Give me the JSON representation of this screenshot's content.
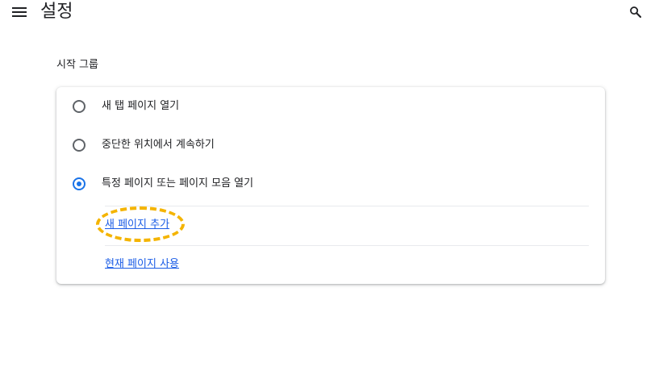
{
  "header": {
    "title": "설정",
    "menu_icon": "hamburger-menu-icon",
    "search_icon": "search-icon"
  },
  "section": {
    "title": "시작 그룹"
  },
  "startup_options": [
    {
      "label": "새 탭 페이지 열기",
      "checked": false
    },
    {
      "label": "중단한 위치에서 계속하기",
      "checked": false
    },
    {
      "label": "특정 페이지 또는 페이지 모음 열기",
      "checked": true
    }
  ],
  "links": {
    "add_page": "새 페이지 추가",
    "use_current": "현재 페이지 사용"
  },
  "colors": {
    "accent": "#1a73e8",
    "link": "#1a5ce6",
    "highlight": "#f4b400"
  }
}
